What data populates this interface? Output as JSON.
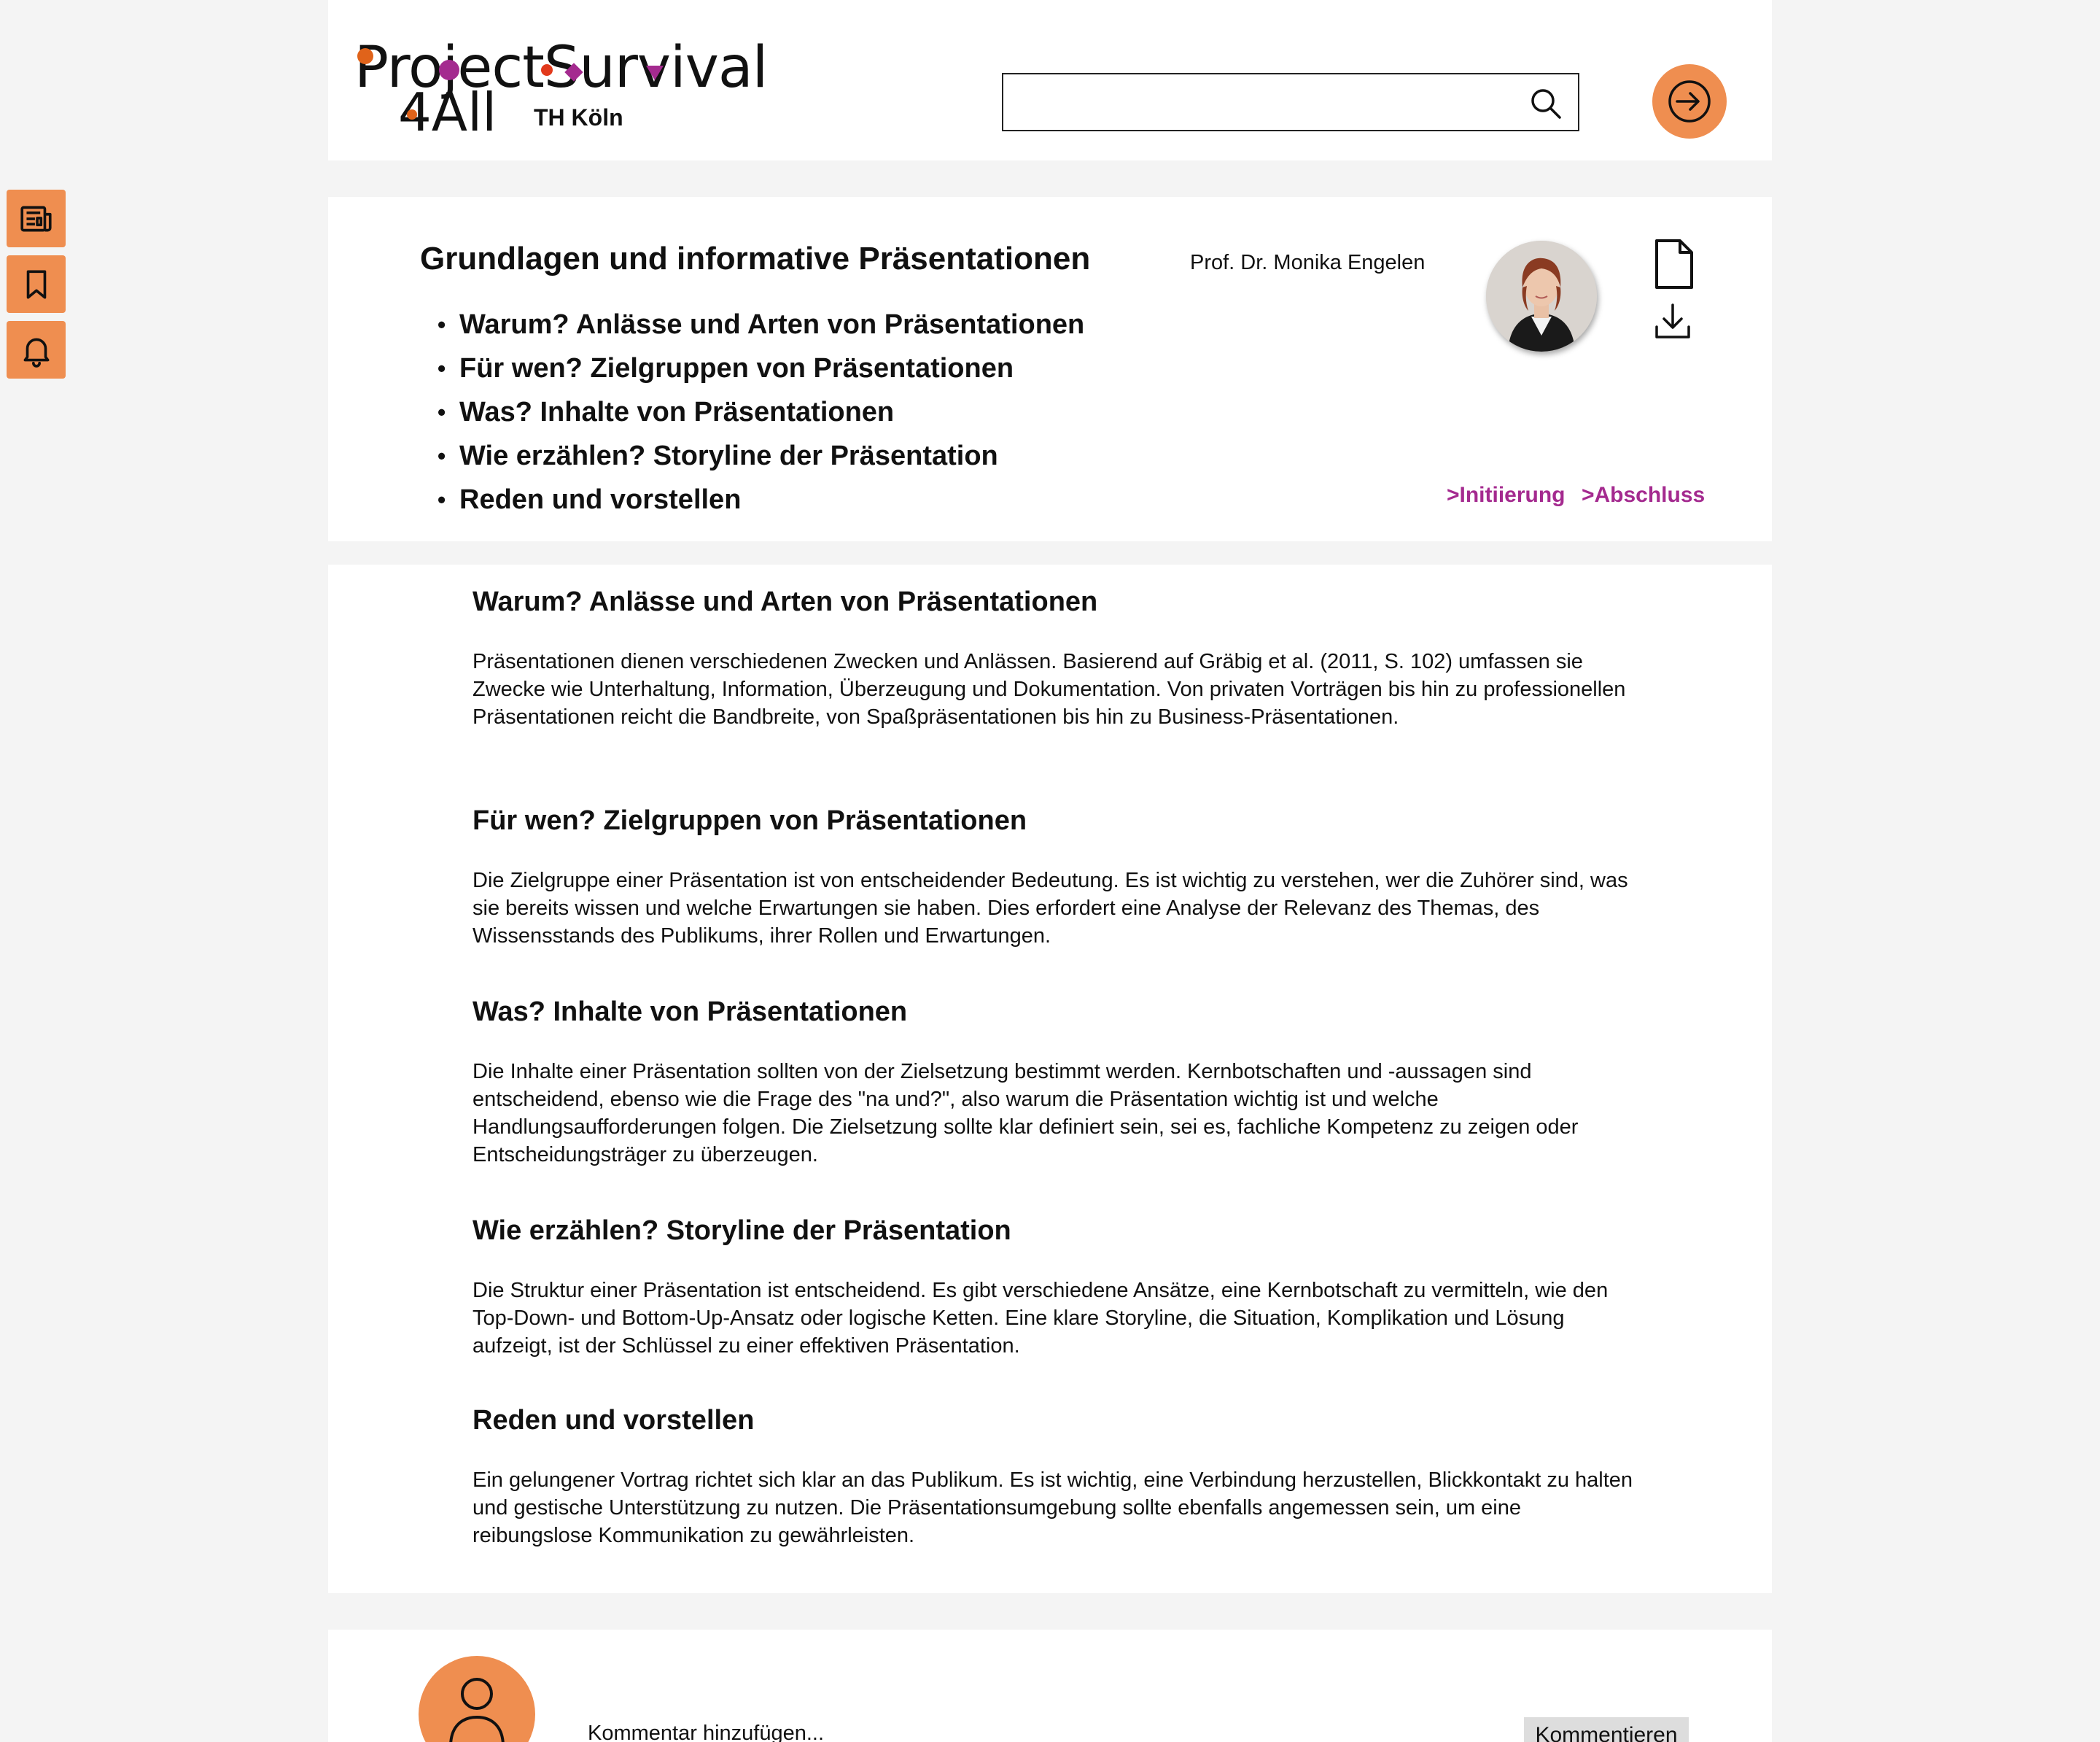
{
  "sidebar": {
    "items": [
      {
        "icon": "newspaper-icon",
        "label": "News"
      },
      {
        "icon": "bookmark-icon",
        "label": "Bookmarks"
      },
      {
        "icon": "bell-icon",
        "label": "Notifications"
      }
    ]
  },
  "header": {
    "logo": {
      "line1": "ProjectSurvival",
      "line2": "4All",
      "sub": "TH Köln"
    },
    "search": {
      "placeholder": "",
      "value": ""
    },
    "search_icon": "search-icon",
    "login_icon": "login-icon"
  },
  "intro": {
    "title": "Grundlagen und informative Präsentationen",
    "toc": [
      "Warum? Anlässe und Arten von Präsentationen",
      "Für wen? Zielgruppen von Präsentationen",
      "Was? Inhalte von Präsentationen",
      "Wie erzählen? Storyline der Präsentation",
      "Reden und vorstellen"
    ],
    "author": "Prof. Dr. Monika Engelen",
    "breadcrumbs": [
      ">Initiierung",
      ">Abschluss"
    ]
  },
  "sections": [
    {
      "heading": "Warum? Anlässe und Arten von Präsentationen",
      "text": "Präsentationen dienen verschiedenen Zwecken und Anlässen. Basierend auf Gräbig et al. (2011, S. 102) umfassen sie Zwecke wie Unterhaltung, Information, Überzeugung und Dokumentation. Von privaten Vorträgen bis hin zu professionellen Präsentationen reicht die Bandbreite, von Spaßpräsentationen bis hin zu Business-Präsentationen."
    },
    {
      "heading": "Für wen? Zielgruppen von Präsentationen",
      "text": "Die Zielgruppe einer Präsentation ist von entscheidender Bedeutung. Es ist wichtig zu verstehen, wer die Zuhörer sind, was sie bereits wissen und welche Erwartungen sie haben. Dies erfordert eine Analyse der Relevanz des Themas, des Wissensstands des Publikums, ihrer Rollen und Erwartungen."
    },
    {
      "heading": "Was? Inhalte von Präsentationen",
      "text": "Die Inhalte einer Präsentation sollten von der Zielsetzung bestimmt werden. Kernbotschaften und -aussagen sind entscheidend, ebenso wie die Frage des \"na und?\", also warum die Präsentation wichtig ist und welche Handlungsaufforderungen folgen. Die Zielsetzung sollte klar definiert sein, sei es, fachliche Kompetenz zu zeigen oder Entscheidungsträger zu überzeugen."
    },
    {
      "heading": "Wie erzählen? Storyline der Präsentation",
      "text": "Die Struktur einer Präsentation ist entscheidend. Es gibt verschiedene Ansätze, eine Kernbotschaft zu vermitteln, wie den Top-Down- und Bottom-Up-Ansatz oder logische Ketten. Eine klare Storyline, die Situation, Komplikation und Lösung aufzeigt, ist der Schlüssel zu einer effektiven Präsentation."
    },
    {
      "heading": "Reden und vorstellen",
      "text": "Ein gelungener Vortrag richtet sich klar an das Publikum. Es ist wichtig, eine Verbindung herzustellen, Blickkontakt zu halten und gestische Unterstützung zu nutzen. Die Präsentationsumgebung sollte ebenfalls angemessen sein, um eine reibungslose Kommunikation zu gewährleisten."
    }
  ],
  "comment": {
    "placeholder": "Kommentar hinzufügen...",
    "button": "Kommentieren"
  },
  "colors": {
    "accent": "#ef8e50",
    "link": "#a42a8f",
    "background": "#f4f4f4",
    "card": "#ffffff"
  }
}
